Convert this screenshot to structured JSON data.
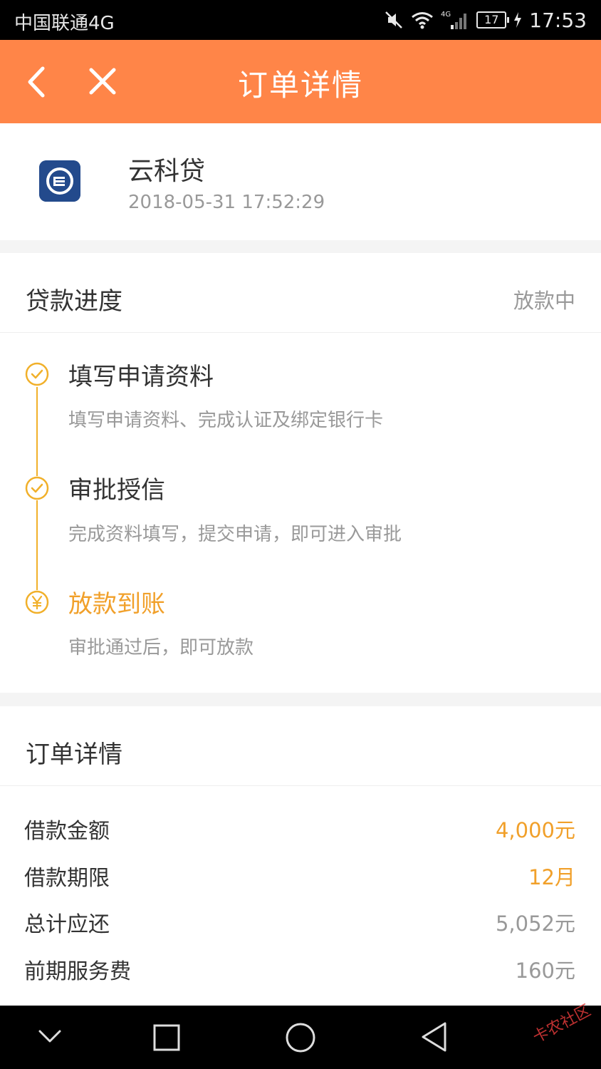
{
  "status_bar": {
    "carrier": "中国联通4G",
    "battery": "17",
    "time": "17:53",
    "network": "4G"
  },
  "header": {
    "title": "订单详情",
    "back_icon": "chevron-left-icon",
    "close_icon": "close-icon"
  },
  "app": {
    "name": "云科贷",
    "datetime": "2018-05-31 17:52:29",
    "logo_color": "#234a8c"
  },
  "progress": {
    "title": "贷款进度",
    "status": "放款中",
    "steps": [
      {
        "title": "填写申请资料",
        "desc": "填写申请资料、完成认证及绑定银行卡",
        "icon": "check-circle-icon"
      },
      {
        "title": "审批授信",
        "desc": "完成资料填写，提交申请，即可进入审批",
        "icon": "check-circle-icon"
      },
      {
        "title": "放款到账",
        "desc": "审批通过后，即可放款",
        "icon": "yuan-circle-icon"
      }
    ]
  },
  "order": {
    "title": "订单详情",
    "rows": [
      {
        "label": "借款金额",
        "value": "4,000元"
      },
      {
        "label": "借款期限",
        "value": "12月"
      },
      {
        "label": "总计应还",
        "value": "5,052元"
      },
      {
        "label": "前期服务费",
        "value": "160元"
      }
    ]
  },
  "nav": {
    "watermark": "卡农社区"
  },
  "colors": {
    "header": "#ff8548",
    "accent": "#f1a02a",
    "text": "#333333",
    "muted": "#999999"
  }
}
